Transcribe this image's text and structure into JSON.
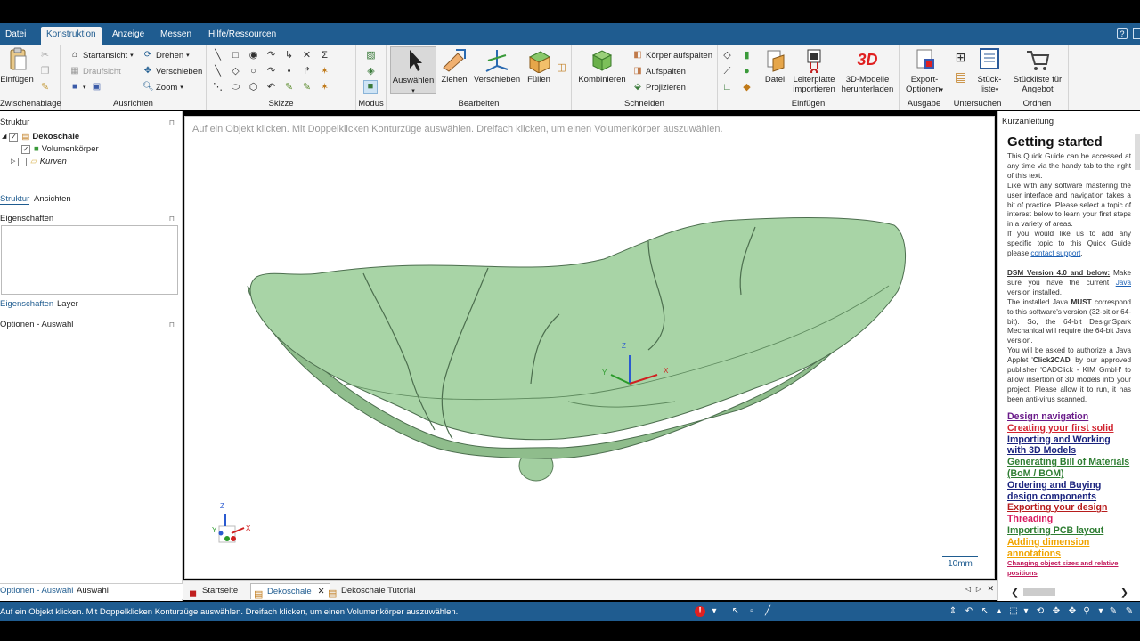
{
  "menu": {
    "tabs": [
      "Datei",
      "Konstruktion",
      "Anzeige",
      "Messen",
      "Hilfe/Ressourcen"
    ],
    "active_tab": "Konstruktion",
    "help_icon": "?"
  },
  "ribbon": {
    "clipboard": {
      "label": "Zwischenablage",
      "paste": "Einfügen"
    },
    "ausrichten": {
      "label": "Ausrichten",
      "startansicht": "Startansicht",
      "draufsicht": "Draufsicht",
      "drehen": "Drehen",
      "verschieben": "Verschieben",
      "zoom": "Zoom"
    },
    "skizze": {
      "label": "Skizze",
      "sigma": "Σ"
    },
    "modus": {
      "label": "Modus"
    },
    "bearbeiten": {
      "label": "Bearbeiten",
      "auswaehlen": "Auswählen",
      "ziehen": "Ziehen",
      "verschieben": "Verschieben",
      "fuellen": "Füllen"
    },
    "schneiden": {
      "label": "Schneiden",
      "kombinieren": "Kombinieren",
      "koerper_aufspalten": "Körper aufspalten",
      "aufspalten": "Aufspalten",
      "projizieren": "Projizieren"
    },
    "einfuegen": {
      "label": "Einfügen",
      "datei": "Datei",
      "leiterplatte_1": "Leiterplatte",
      "leiterplatte_2": "importieren",
      "modelle_1": "3D-Modelle",
      "modelle_2": "herunterladen",
      "badge_3d": "3D"
    },
    "ausgabe": {
      "label": "Ausgabe",
      "export_1": "Export-",
      "export_2": "Optionen"
    },
    "untersuchen": {
      "label": "Untersuchen",
      "stueckliste_1": "Stück-",
      "stueckliste_2": "liste"
    },
    "ordnen": {
      "label": "Ordnen",
      "stueckliste_angebot_1": "Stückliste für",
      "stueckliste_angebot_2": "Angebot"
    }
  },
  "left_panel": {
    "struktur_title": "Struktur",
    "tree": [
      {
        "label": "Dekoschale",
        "bold": true
      },
      {
        "label": "Volumenkörper",
        "bold": false
      },
      {
        "label": "Kurven",
        "italic": true
      }
    ],
    "tabs1": [
      "Struktur",
      "Ansichten"
    ],
    "eigenschaften_title": "Eigenschaften",
    "tabs2": [
      "Eigenschaften",
      "Layer"
    ],
    "optionen_title": "Optionen - Auswahl",
    "bottom_tabs": [
      "Optionen - Auswahl",
      "Auswahl"
    ]
  },
  "viewport": {
    "hint": "Auf ein Objekt klicken. Mit Doppelklicken Konturzüge auswählen. Dreifach klicken, um einen Volumenkörper auszuwählen.",
    "scale_label": "10mm",
    "axis_x": "X",
    "axis_y": "Y",
    "axis_z": "Z",
    "colors": {
      "model_fill": "#a8d4a6",
      "model_stroke": "#4c6e4e",
      "accent": "#1f5c90"
    }
  },
  "doc_tabs": [
    "Startseite",
    "Dekoschale",
    "Dekoschale Tutorial"
  ],
  "quick_guide": {
    "header": "Kurzanleitung",
    "title": "Getting started",
    "p1": "This Quick Guide can be accessed at any time via the handy tab to the right of this text.",
    "p2": "Like with any software mastering the user interface and navigation takes a bit of practice. Please select a topic of interest below to learn your first steps in a variety of areas.",
    "p3_prefix": "If you would like us to add any specific topic to this Quick Guide please ",
    "p3_link": "contact support",
    "p3_suffix": ".",
    "dsm_bold": "DSM Version 4.0 and below:",
    "dsm_text": " Make sure you have the current ",
    "java_link": "Java",
    "dsm_text2": " version installed.",
    "java_must_1": "The installed Java ",
    "java_must_bold": "MUST",
    "java_must_2": " correspond to this software's version (32-bit or 64-bit). So, the 64-bit DesignSpark Mechanical will require the 64-bit Java version.",
    "applet_1": "You will be asked to authorize a Java Applet '",
    "applet_bold": "Click2CAD",
    "applet_2": "' by our approved publisher 'CADClick - KIM GmbH' to allow insertion of 3D models into your project. Please allow it to run, it has been anti-virus scanned.",
    "links": [
      {
        "text": "Design navigation",
        "color": "#6a1b8a"
      },
      {
        "text": "Creating your first solid",
        "color": "#d1242f"
      },
      {
        "text": "Importing and Working with 3D Models",
        "color": "#1a237e"
      },
      {
        "text": "Generating Bill of Materials (BoM / BOM)",
        "color": "#2e7d32"
      },
      {
        "text": "Ordering and Buying design components",
        "color": "#1a237e"
      },
      {
        "text": "Exporting your design",
        "color": "#b71c1c"
      },
      {
        "text": "Threading",
        "color": "#d81b60"
      },
      {
        "text": "Importing PCB layout",
        "color": "#2e7d32"
      },
      {
        "text": "Adding dimension annotations",
        "color": "#f0a400"
      },
      {
        "text": "Changing object sizes and relative positions",
        "color": "#c2185b",
        "small": true
      }
    ]
  },
  "status": {
    "message": "Auf ein Objekt klicken. Mit Doppelklicken Konturzüge auswählen. Dreifach klicken, um einen Volumenkörper auszuwählen.",
    "error_badge": "!"
  }
}
